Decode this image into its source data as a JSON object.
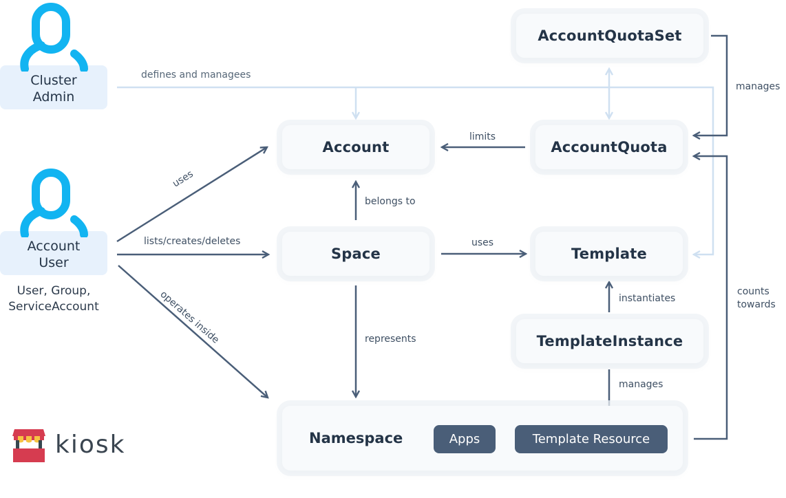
{
  "actors": {
    "cluster_admin": {
      "lines": [
        "Cluster",
        "Admin"
      ]
    },
    "account_user": {
      "lines": [
        "Account",
        "User"
      ],
      "subtitle_lines": [
        "User, Group,",
        "ServiceAccount"
      ]
    }
  },
  "nodes": {
    "account_quota_set": "AccountQuotaSet",
    "account": "Account",
    "account_quota": "AccountQuota",
    "space": "Space",
    "template": "Template",
    "template_instance": "TemplateInstance",
    "namespace": "Namespace",
    "apps": "Apps",
    "template_resource": "Template Resource"
  },
  "edges": {
    "defines_and_manages": "defines and managees",
    "uses_account": "uses",
    "lists_creates_deletes": "lists/creates/deletes",
    "operates_inside": "operates inside",
    "limits": "limits",
    "belongs_to": "belongs to",
    "uses_template": "uses",
    "represents": "represents",
    "instantiates": "instantiates",
    "manages_resource": "manages",
    "manages_quota": "manages",
    "counts_towards": [
      "counts",
      "towards"
    ]
  },
  "logo": {
    "text": "kiosk"
  },
  "colors": {
    "edge_dark": "#4a5e78",
    "edge_light": "#cfe0f1",
    "actor_icon": "#12b4f1",
    "actor_bg": "#e7f1fc",
    "node_bg": "#f8fafc",
    "logo_red": "#d63c50",
    "logo_yellow": "#f6c343"
  }
}
